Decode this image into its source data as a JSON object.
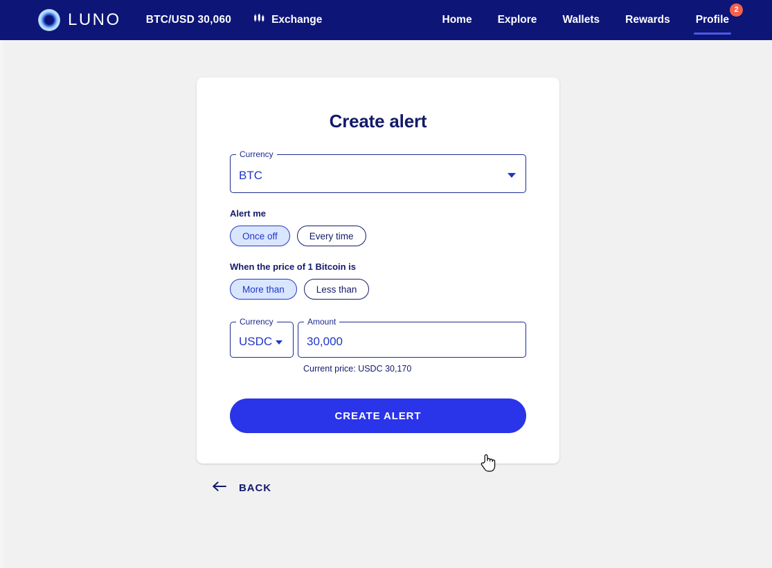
{
  "header": {
    "logo_text": "LUNO",
    "logo_icon": "luno-ring-logo",
    "ticker": "BTC/USD 30,060",
    "exchange_label": "Exchange",
    "exchange_icon": "candlestick-chart-icon",
    "nav": [
      {
        "label": "Home",
        "active": false
      },
      {
        "label": "Explore",
        "active": false
      },
      {
        "label": "Wallets",
        "active": false
      },
      {
        "label": "Rewards",
        "active": false
      },
      {
        "label": "Profile",
        "active": true,
        "badge": "2"
      }
    ],
    "colors": {
      "background": "#0d1577",
      "active_underline": "#4e5ae8",
      "badge": "#f4614e"
    }
  },
  "card": {
    "title": "Create alert",
    "currency_field": {
      "legend": "Currency",
      "value": "BTC",
      "caret_icon": "chevron-down-icon"
    },
    "alert_me": {
      "label": "Alert me",
      "options": [
        {
          "label": "Once off",
          "selected": true
        },
        {
          "label": "Every time",
          "selected": false
        }
      ]
    },
    "condition": {
      "label": "When the price of 1 Bitcoin is",
      "options": [
        {
          "label": "More than",
          "selected": true
        },
        {
          "label": "Less than",
          "selected": false
        }
      ]
    },
    "amount_row": {
      "currency_legend": "Currency",
      "currency_value": "USDC",
      "currency_caret_icon": "chevron-down-icon",
      "amount_legend": "Amount",
      "amount_value": "30,000",
      "amount_placeholder": "0"
    },
    "current_price": "Current price: USDC 30,170",
    "submit_label": "CREATE ALERT",
    "colors": {
      "primary": "#2a34e8",
      "navy": "#131a6b",
      "chip_selected_bg": "#d9e6ff",
      "card_bg": "#ffffff"
    }
  },
  "footer": {
    "back_label": "BACK",
    "back_icon": "arrow-left-icon"
  },
  "page": {
    "background": "#f1f1f1",
    "cursor_icon": "pointing-hand-cursor"
  }
}
